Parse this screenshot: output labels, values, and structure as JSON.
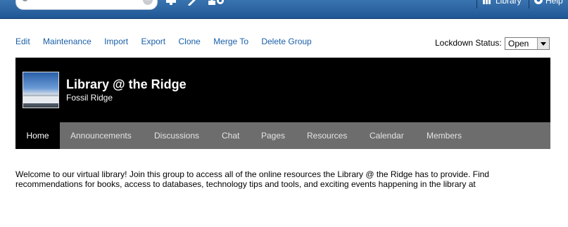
{
  "topbar": {
    "search": {
      "placeholder": "",
      "clear_glyph": "×"
    },
    "icons": [
      "monitor-icon",
      "wand-icon",
      "users-gear-icon"
    ],
    "library_label": "Library",
    "help_label": "Help"
  },
  "actions": [
    "Edit",
    "Maintenance",
    "Import",
    "Export",
    "Clone",
    "Merge To",
    "Delete Group"
  ],
  "lockdown": {
    "label": "Lockdown Status:",
    "value": "Open"
  },
  "group": {
    "title": "Library @ the Ridge",
    "subtitle": "Fossil Ridge"
  },
  "tabs": [
    "Home",
    "Announcements",
    "Discussions",
    "Chat",
    "Pages",
    "Resources",
    "Calendar",
    "Members"
  ],
  "welcome_text": "Welcome to our virtual library! Join this group to access all of the online resources the Library @ the Ridge has to provide. Find recommendations for books, access to databases, technology tips and tools, and exciting events happening in the library at"
}
